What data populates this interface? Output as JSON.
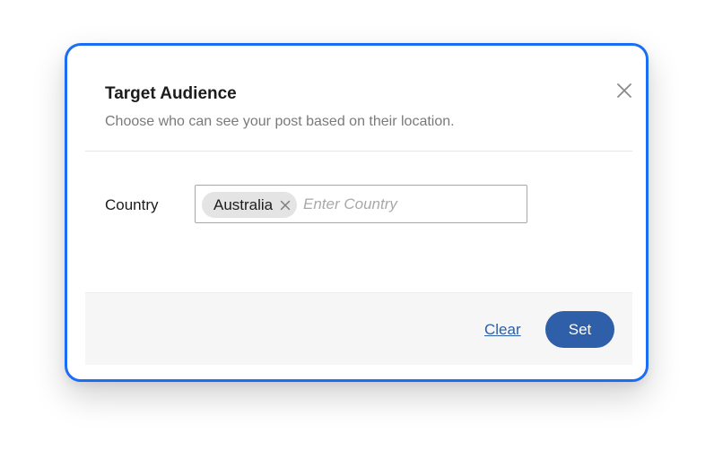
{
  "dialog": {
    "title": "Target Audience",
    "subtitle": "Choose who can see your post based on their location.",
    "close_icon": "close-icon"
  },
  "form": {
    "country_label": "Country",
    "selected_countries": [
      {
        "label": "Australia",
        "remove_icon": "close-icon"
      }
    ],
    "country_input": {
      "value": "",
      "placeholder": "Enter Country"
    }
  },
  "footer": {
    "clear_label": "Clear",
    "set_label": "Set"
  },
  "colors": {
    "dialog_border": "#1a6ef5",
    "primary_button": "#2e5fa8",
    "link": "#2b5ea9",
    "chip_background": "#e4e4e4",
    "footer_background": "#f6f6f6"
  }
}
